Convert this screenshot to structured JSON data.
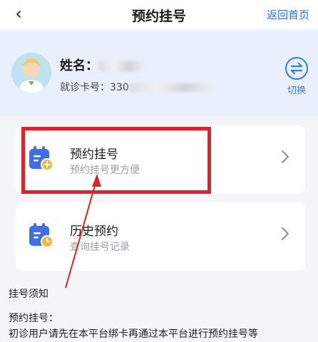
{
  "nav": {
    "back_icon": "chevron-left-icon",
    "title": "预约挂号",
    "right_link": "返回首页"
  },
  "user": {
    "name_label": "姓名：",
    "name_value": "",
    "card_label": "就诊卡号：",
    "card_value": "330",
    "switch_label": "切换"
  },
  "menu": [
    {
      "title": "预约挂号",
      "subtitle": "预约挂号更方便",
      "icon": "calendar-plus-icon"
    },
    {
      "title": "历史预约",
      "subtitle": "查询挂号记录",
      "icon": "calendar-clock-icon"
    }
  ],
  "notice": {
    "title": "挂号须知",
    "subtitle": "预约挂号：",
    "text": "初诊用户请先在本平台绑卡再通过本平台进行预约挂号等"
  },
  "colors": {
    "accent": "#2f6de1",
    "highlight": "#e0202a",
    "user_band": "#eaf0fb"
  }
}
